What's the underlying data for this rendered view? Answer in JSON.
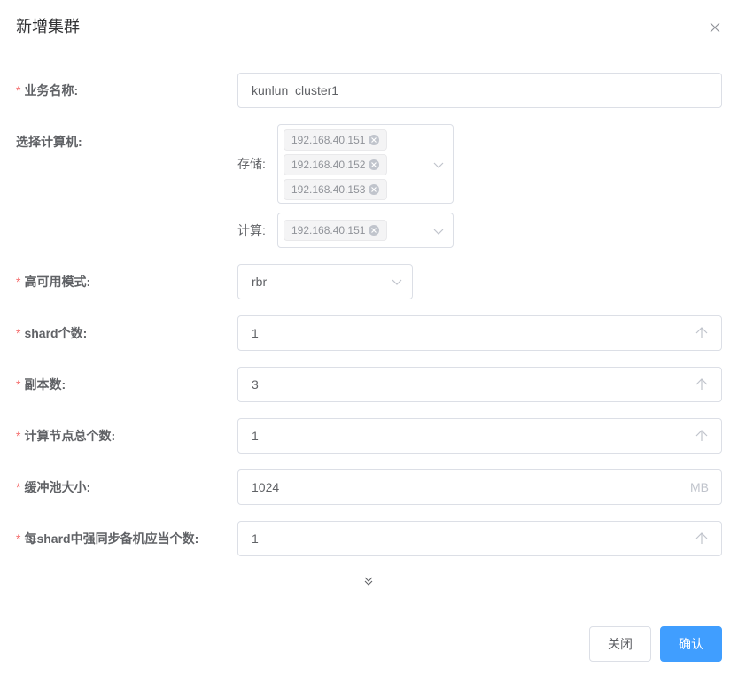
{
  "dialog": {
    "title": "新增集群",
    "close_icon": "close-icon"
  },
  "required_mark": "*",
  "fields": {
    "business_name": {
      "label": "业务名称:",
      "value": "kunlun_cluster1"
    },
    "select_machines": {
      "label": "选择计算机:",
      "storage": {
        "label": "存储:",
        "selected": [
          "192.168.40.151",
          "192.168.40.152",
          "192.168.40.153"
        ]
      },
      "compute": {
        "label": "计算:",
        "selected": [
          "192.168.40.151"
        ]
      }
    },
    "ha_mode": {
      "label": "高可用模式:",
      "value": "rbr"
    },
    "shard_count": {
      "label": "shard个数:",
      "value": "1"
    },
    "replica_count": {
      "label": "副本数:",
      "value": "3"
    },
    "compute_node_total": {
      "label": "计算节点总个数:",
      "value": "1"
    },
    "buffer_pool_size": {
      "label": "缓冲池大小:",
      "value": "1024",
      "unit": "MB"
    },
    "sync_standby_per_shard": {
      "label": "每shard中强同步备机应当个数:",
      "value": "1"
    }
  },
  "expand_icon": "double-chevron-down-icon",
  "footer": {
    "close_label": "关闭",
    "confirm_label": "确认"
  },
  "colors": {
    "primary": "#409eff",
    "required": "#f56c6c",
    "border": "#dcdfe6",
    "tag_bg": "#f4f4f5"
  }
}
